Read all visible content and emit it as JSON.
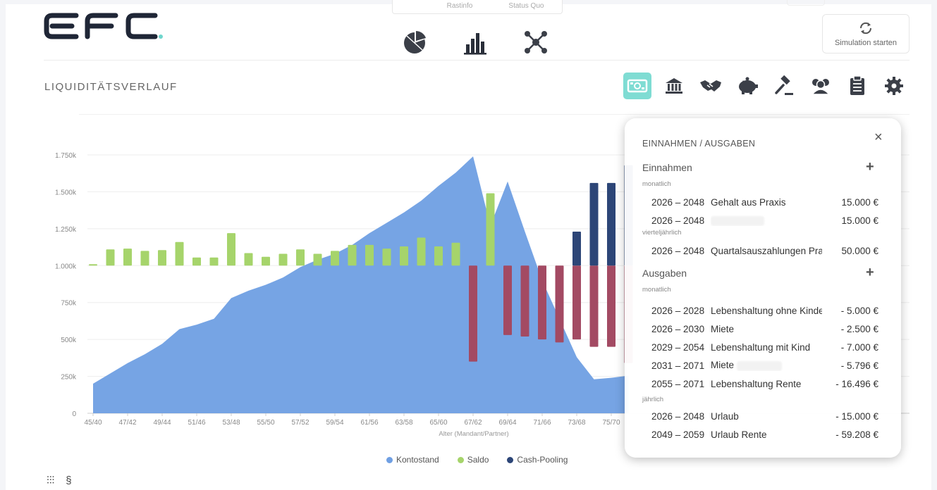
{
  "header": {
    "logo_text": "EFC",
    "crumbs": [
      "",
      "Rastinfo",
      "Status Quo"
    ],
    "simulation_button": "Simulation starten",
    "view_icons": [
      "pie-chart-icon",
      "bar-chart-icon",
      "network-icon"
    ]
  },
  "section": {
    "title": "LIQUIDITÄTSVERLAUF",
    "tools": [
      "money-icon",
      "bank-icon",
      "handshake-icon",
      "piggy-bank-icon",
      "gavel-icon",
      "people-icon",
      "clipboard-icon",
      "gear-icon"
    ]
  },
  "panel": {
    "title": "EINNAHMEN / AUSGABEN",
    "close": "×",
    "income": {
      "title": "Einnahmen",
      "groups": [
        {
          "freq": "monatlich",
          "rows": [
            {
              "years": "2026 – 2048",
              "label": "Gehalt aus Praxis",
              "amount": "15.000 €"
            },
            {
              "years": "2026 – 2048",
              "label": "",
              "amount": "15.000 €"
            }
          ]
        },
        {
          "freq": "vierteljährlich",
          "rows": [
            {
              "years": "2026 – 2048",
              "label": "Quartalsauszahlungen Pra...",
              "amount": "50.000 €"
            }
          ]
        }
      ]
    },
    "expenses": {
      "title": "Ausgaben",
      "groups": [
        {
          "freq": "monatlich",
          "rows": [
            {
              "years": "2026 – 2028",
              "label": "Lebenshaltung ohne Kinder",
              "amount": "- 5.000 €"
            },
            {
              "years": "2026 – 2030",
              "label": "Miete",
              "amount": "- 2.500 €"
            },
            {
              "years": "2029 – 2054",
              "label": "Lebenshaltung mit Kind",
              "amount": "- 7.000 €"
            },
            {
              "years": "2031 – 2071",
              "label": "Miete",
              "amount": "- 5.796 €"
            },
            {
              "years": "2055 – 2071",
              "label": "Lebenshaltung Rente",
              "amount": "- 16.496 €"
            }
          ]
        },
        {
          "freq": "jährlich",
          "rows": [
            {
              "years": "2026 – 2048",
              "label": "Urlaub",
              "amount": "- 15.000 €"
            },
            {
              "years": "2049 – 2059",
              "label": "Urlaub Rente",
              "amount": "- 59.208 €"
            }
          ]
        }
      ]
    }
  },
  "legend": [
    {
      "name": "Kontostand",
      "color": "#6f9fe3"
    },
    {
      "name": "Saldo",
      "color": "#a6d46b"
    },
    {
      "name": "Cash-Pooling",
      "color": "#2c4577"
    }
  ],
  "chart_data": {
    "type": "bar",
    "xlabel": "Alter (Mandant/Partner)",
    "ylabel": "",
    "y_ticks": [
      "0",
      "250k",
      "500k",
      "750k",
      "1.000k",
      "1.250k",
      "1.500k",
      "1.750k"
    ],
    "ylim": [
      0,
      1750000
    ],
    "x_tick_labels": [
      "45/40",
      "47/42",
      "49/44",
      "51/46",
      "53/48",
      "55/50",
      "57/52",
      "59/54",
      "61/56",
      "63/58",
      "65/60",
      "67/62",
      "69/64",
      "71/66",
      "73/68",
      "75/70"
    ],
    "categories": [
      "45/40",
      "46/41",
      "47/42",
      "48/43",
      "49/44",
      "50/45",
      "51/46",
      "52/47",
      "53/48",
      "54/49",
      "55/50",
      "56/51",
      "57/52",
      "58/53",
      "59/54",
      "60/55",
      "61/56",
      "62/57",
      "63/58",
      "64/59",
      "65/60",
      "66/61",
      "67/62",
      "68/63",
      "69/64",
      "70/65",
      "71/66",
      "72/67",
      "73/68",
      "74/69",
      "75/70",
      "76/71"
    ],
    "series": [
      {
        "name": "Kontostand",
        "type": "area",
        "values": [
          200000,
          270000,
          340000,
          400000,
          470000,
          570000,
          600000,
          640000,
          780000,
          830000,
          870000,
          920000,
          990000,
          1040000,
          1080000,
          1140000,
          1220000,
          1290000,
          1360000,
          1440000,
          1540000,
          1630000,
          1740000,
          1270000,
          1570000,
          1230000,
          900000,
          640000,
          380000,
          230000,
          240000,
          255000
        ]
      },
      {
        "name": "Saldo",
        "type": "bar",
        "values": [
          10000,
          110000,
          115000,
          100000,
          105000,
          160000,
          55000,
          55000,
          220000,
          85000,
          60000,
          80000,
          110000,
          80000,
          100000,
          140000,
          140000,
          115000,
          130000,
          190000,
          130000,
          155000,
          -650000,
          490000,
          -470000,
          -480000,
          -500000,
          -520000,
          -500000,
          -550000,
          -550000,
          -660000
        ]
      },
      {
        "name": "Cash-Pooling",
        "type": "bar",
        "values": [
          0,
          0,
          0,
          0,
          0,
          0,
          0,
          0,
          0,
          0,
          0,
          0,
          0,
          0,
          0,
          0,
          0,
          0,
          0,
          0,
          0,
          0,
          0,
          0,
          0,
          0,
          0,
          0,
          230000,
          560000,
          560000,
          680000
        ]
      }
    ]
  }
}
